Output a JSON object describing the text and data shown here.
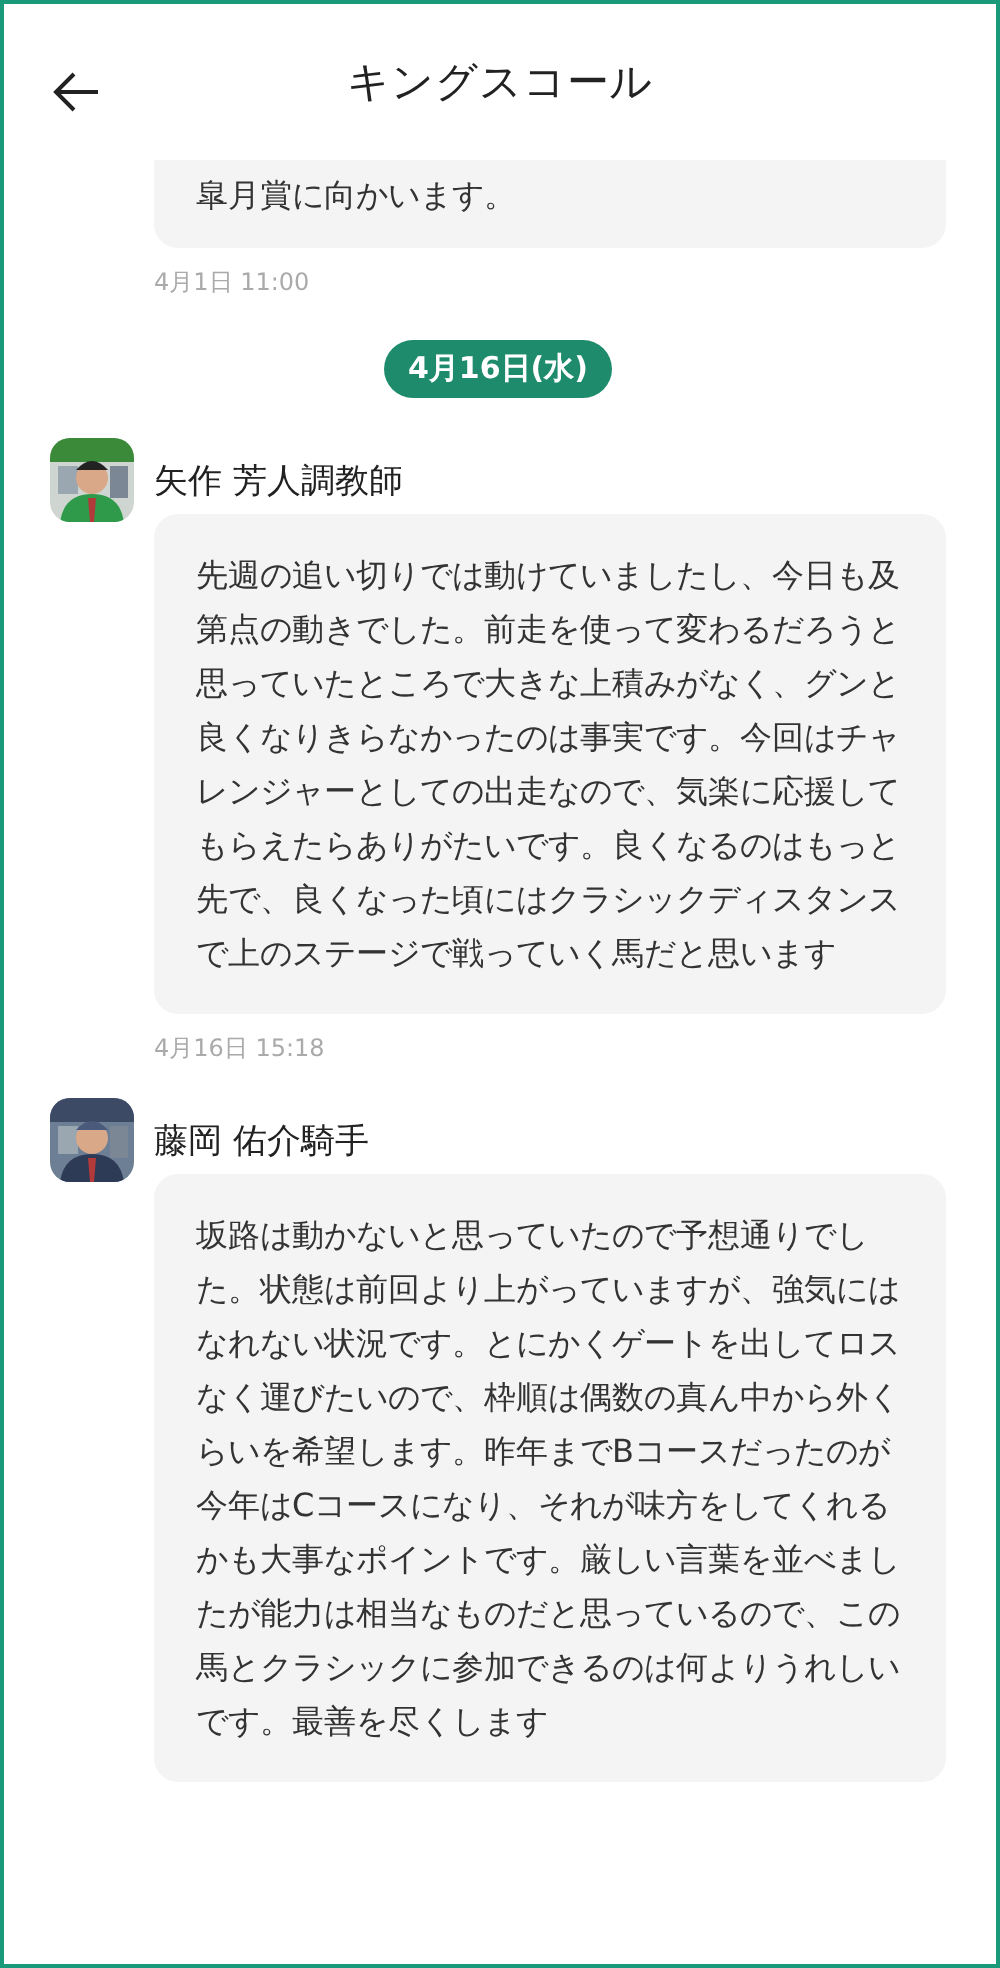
{
  "header": {
    "title": "キングスコール"
  },
  "items": [
    {
      "kind": "continued",
      "text": "皐月賞に向かいます。",
      "time": "4月1日 11:00"
    },
    {
      "kind": "date",
      "label": "4月16日(水)"
    },
    {
      "kind": "message",
      "sender": "矢作 芳人調教師",
      "text": "先週の追い切りでは動けていましたし、今日も及第点の動きでした。前走を使って変わるだろうと思っていたところで大きな上積みがなく、グンと良くなりきらなかったのは事実です。今回はチャレンジャーとしての出走なので、気楽に応援してもらえたらありがたいです。良くなるのはもっと先で、良くなった頃にはクラシックディスタンスで上のステージで戦っていく馬だと思います",
      "time": "4月16日 15:18"
    },
    {
      "kind": "message",
      "sender": "藤岡 佑介騎手",
      "text": "坂路は動かないと思っていたので予想通りでした。状態は前回より上がっていますが、強気にはなれない状況です。とにかくゲートを出してロスなく運びたいので、枠順は偶数の真ん中から外くらいを希望します。昨年までBコースだったのが今年はCコースになり、それが味方をしてくれるかも大事なポイントです。厳しい言葉を並べましたが能力は相当なものだと思っているので、この馬とクラシックに参加できるのは何よりうれしいです。最善を尽くします"
    }
  ]
}
